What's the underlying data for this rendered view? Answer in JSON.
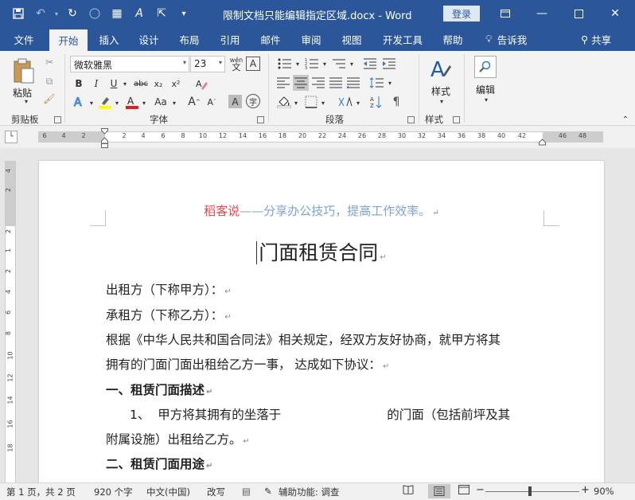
{
  "title_bar": {
    "doc_title": "限制文档只能编辑指定区域.docx  -  Word",
    "login_label": "登录",
    "qat_icons": [
      "save-icon",
      "undo-icon",
      "redo-icon",
      "touch-mode-icon",
      "format-painter-icon",
      "font-size-icon",
      "select-icon",
      "customize-icon"
    ]
  },
  "tabs": [
    "文件",
    "开始",
    "插入",
    "设计",
    "布局",
    "引用",
    "邮件",
    "审阅",
    "视图",
    "开发工具",
    "帮助"
  ],
  "tell_me": "告诉我",
  "share": "共享",
  "ribbon": {
    "paste_label": "粘贴",
    "clipboard_group": "剪贴板",
    "font_name": "微软雅黑",
    "font_size": "23",
    "font_group": "字体",
    "paragraph_group": "段落",
    "styles_label": "样式",
    "styles_group": "样式",
    "editing_label": "编辑",
    "bold": "B",
    "italic": "I",
    "underline": "U",
    "strike": "abc",
    "subscript": "x₂",
    "superscript": "x²",
    "aa_case": "Aa",
    "grow": "A",
    "shrink": "A",
    "wen": "wén"
  },
  "ruler": {
    "h_numbers": [
      "6",
      "4",
      "2",
      "2",
      "4",
      "6",
      "8",
      "10",
      "12",
      "14",
      "16",
      "18",
      "20",
      "22",
      "24",
      "26",
      "28",
      "30",
      "32",
      "34",
      "36",
      "38",
      "40",
      "42",
      "46",
      "48"
    ],
    "v_numbers": [
      "4",
      "2",
      "2",
      "1",
      "2",
      "4",
      "6",
      "8",
      "10",
      "12",
      "14",
      "16",
      "18"
    ]
  },
  "document": {
    "header_red": "稻客说",
    "header_blue": "——分享办公技巧，提高工作效率。",
    "title": "门面租赁合同",
    "lines": [
      "出租方（下称甲方）：",
      "承租方（下称乙方）：",
      "根据《中华人民共和国合同法》相关规定，经双方友好协商，就甲方将其",
      "拥有的门面门面出租给乙方一事，  达成如下协议：",
      "一、租赁门面描述",
      "1、  甲方将其拥有的坐落于                           的门面（包括前坪及其",
      "附属设施）出租给乙方。",
      "二、租赁门面用途"
    ],
    "header_red_color": "#e8474c",
    "header_blue_color": "#7ba3d6"
  },
  "status": {
    "page": "第 1 页，共 2 页",
    "words": "920 个字",
    "lang": "中文(中国)",
    "mode": "改写",
    "accessibility": "辅助功能: 调查",
    "zoom": "90%",
    "zoom_minus": "−",
    "zoom_plus": "+"
  },
  "colors": {
    "accent": "#2b579a",
    "ribbon_bg": "#f3f3f3"
  }
}
